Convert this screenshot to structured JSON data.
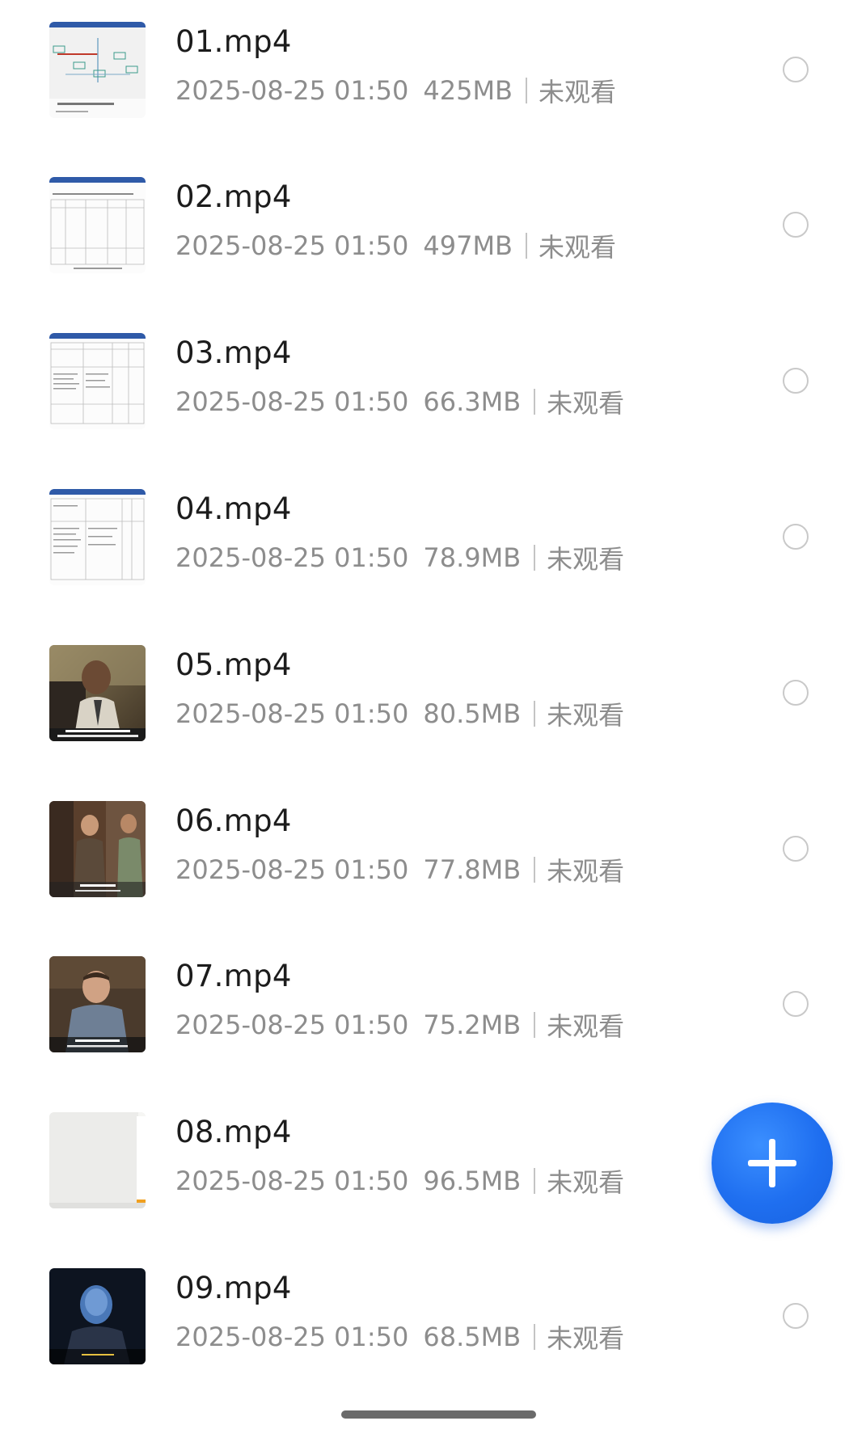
{
  "files": [
    {
      "name": "01.mp4",
      "date": "2025-08-25 01:50",
      "size": "425MB",
      "status": "未观看",
      "thumbnail": "flowchart-document"
    },
    {
      "name": "02.mp4",
      "date": "2025-08-25 01:50",
      "size": "497MB",
      "status": "未观看",
      "thumbnail": "table-document"
    },
    {
      "name": "03.mp4",
      "date": "2025-08-25 01:50",
      "size": "66.3MB",
      "status": "未观看",
      "thumbnail": "table-document"
    },
    {
      "name": "04.mp4",
      "date": "2025-08-25 01:50",
      "size": "78.9MB",
      "status": "未观看",
      "thumbnail": "table-document"
    },
    {
      "name": "05.mp4",
      "date": "2025-08-25 01:50",
      "size": "80.5MB",
      "status": "未观看",
      "thumbnail": "video-frame-man-in-field"
    },
    {
      "name": "06.mp4",
      "date": "2025-08-25 01:50",
      "size": "77.8MB",
      "status": "未观看",
      "thumbnail": "video-frame-two-people"
    },
    {
      "name": "07.mp4",
      "date": "2025-08-25 01:50",
      "size": "75.2MB",
      "status": "未观看",
      "thumbnail": "video-frame-man-speaking"
    },
    {
      "name": "08.mp4",
      "date": "2025-08-25 01:50",
      "size": "96.5MB",
      "status": "未观看",
      "thumbnail": "blank-white-frame"
    },
    {
      "name": "09.mp4",
      "date": "2025-08-25 01:50",
      "size": "68.5MB",
      "status": "未观看",
      "thumbnail": "video-frame-blue-face"
    }
  ],
  "fab": {
    "icon": "plus-icon",
    "color": "#1f6ff0"
  },
  "colors": {
    "name": "#1c1c1c",
    "meta": "#8d8d8d",
    "radio_border": "#c9c9c9"
  }
}
